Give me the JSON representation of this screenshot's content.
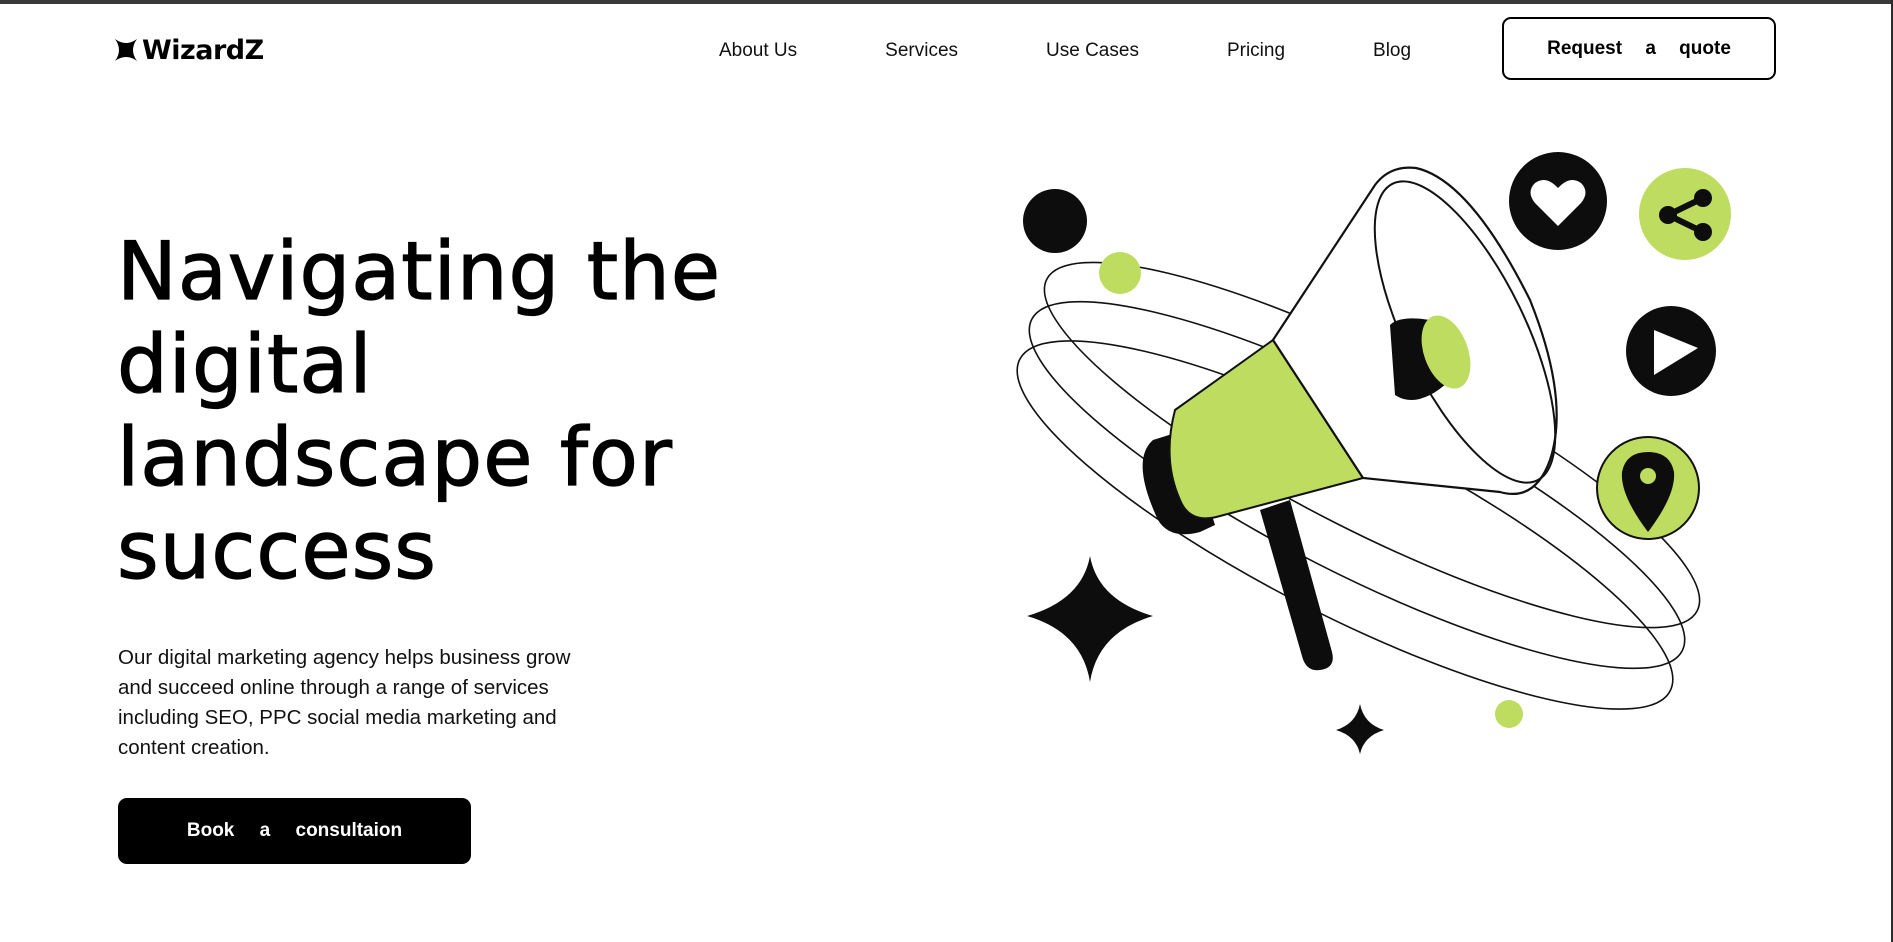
{
  "brand": {
    "name": "WizardZ"
  },
  "nav": {
    "links": [
      "About Us",
      "Services",
      "Use Cases",
      "Pricing",
      "Blog"
    ],
    "cta_label": "Request a quote"
  },
  "hero": {
    "title_lines": [
      "Navigating the",
      "digital",
      "landscape for",
      "success"
    ],
    "description": "Our digital marketing agency helps business grow and succeed online through a range of services including SEO, PPC social media marketing and content creation.",
    "cta_label": "Book a consultaion"
  },
  "illustration": {
    "icons": [
      "megaphone-icon",
      "heart-icon",
      "share-icon",
      "play-icon",
      "location-pin-icon",
      "sparkle-star-icon"
    ]
  },
  "colors": {
    "accent": "#bedc5f",
    "dark": "#0d0d0d",
    "background": "#ffffff"
  }
}
